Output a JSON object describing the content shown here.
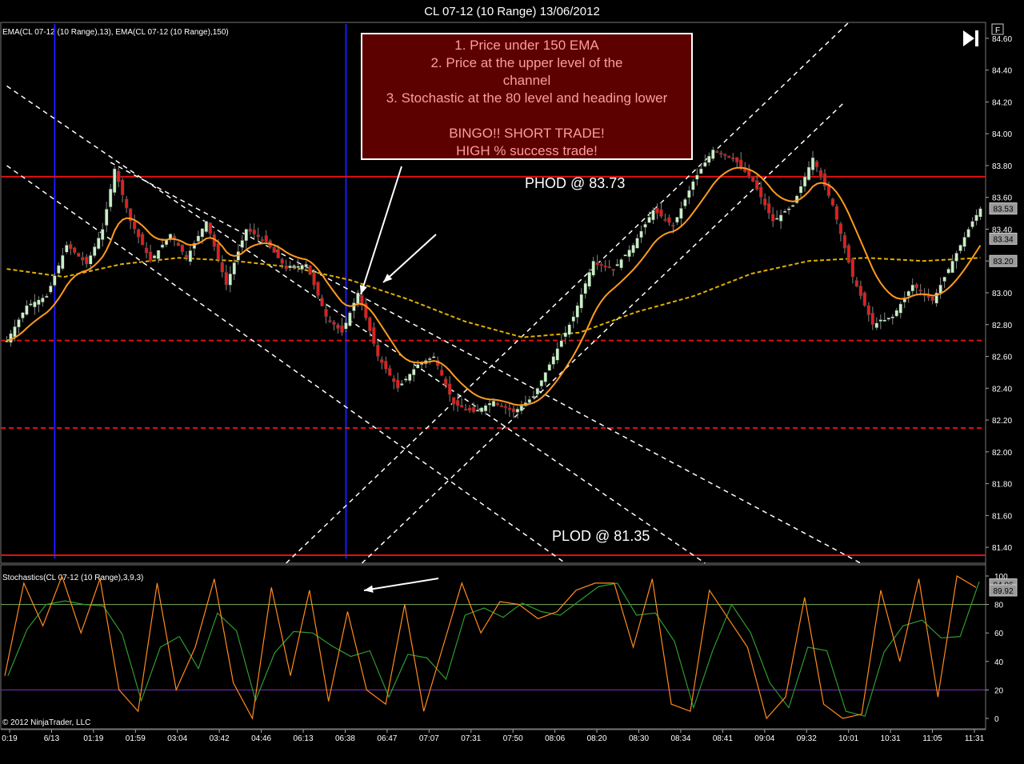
{
  "header": {
    "title": "CL 07-12 (10 Range)  13/06/2012"
  },
  "price_panel": {
    "indicator_label": "EMA(CL 07-12 (10 Range),13), EMA(CL 07-12 (10 Range),150)",
    "axis_ticks": [
      "84.60",
      "84.40",
      "84.20",
      "84.00",
      "83.80",
      "83.60",
      "83.40",
      "83.20",
      "83.00",
      "82.80",
      "82.60",
      "82.40",
      "82.20",
      "82.00",
      "81.80",
      "81.60",
      "81.40"
    ],
    "badges": [
      "83.53",
      "83.34",
      "83.20"
    ],
    "callout": {
      "text": "1. Price under 150 EMA\n2. Price at the upper level of the\nchannel\n3. Stochastic at the 80 level and heading lower\n\nBINGO!!  SHORT TRADE!\nHIGH % success trade!"
    },
    "phod_label": "PHOD @ 83.73",
    "plod_label": "PLOD @ 81.35",
    "f_button": "F",
    "play_icon": "skip-forward-icon"
  },
  "stoch_panel": {
    "indicator_label": "Stochastics(CL 07-12 (10 Range),3,9,3)",
    "axis_ticks": [
      "100",
      "80",
      "60",
      "40",
      "20",
      "0"
    ],
    "badges": [
      "94.06",
      "89.92"
    ],
    "copyright": "© 2012 NinjaTrader, LLC"
  },
  "x_axis": {
    "ticks": [
      "0:19",
      "6/13",
      "01:19",
      "01:59",
      "03:04",
      "03:42",
      "04:46",
      "06:13",
      "06:38",
      "06:47",
      "07:07",
      "07:31",
      "07:50",
      "08:06",
      "08:20",
      "08:30",
      "08:34",
      "08:41",
      "09:04",
      "09:32",
      "10:01",
      "10:31",
      "11:05",
      "11:31"
    ]
  },
  "colors": {
    "background": "#000000",
    "up_candle": "#c8f0c8",
    "down_candle": "#e02020",
    "ema13": "#ff9a1e",
    "ema150": "#e0b000",
    "level_line": "#e01010",
    "session_line": "#1a1aff",
    "stoch_k": "#ff8a1e",
    "stoch_d": "#2f9a2f",
    "stoch_80": "#78b060",
    "stoch_20": "#8030c0",
    "channel": "#ffffff"
  },
  "chart_data": [
    {
      "type": "candlestick",
      "title": "CL 07-12 (10 Range)  13/06/2012",
      "ylim": [
        81.3,
        84.7
      ],
      "x_labels": [
        "0:19",
        "6/13",
        "01:19",
        "01:59",
        "03:04",
        "03:42",
        "04:46",
        "06:13",
        "06:38",
        "06:47",
        "07:07",
        "07:31",
        "07:50",
        "08:06",
        "08:20",
        "08:30",
        "08:34",
        "08:41",
        "09:04",
        "09:32",
        "10:01",
        "10:31",
        "11:05",
        "11:31"
      ],
      "close_path": [
        {
          "bar": 0,
          "price": 82.7
        },
        {
          "bar": 5,
          "price": 82.92
        },
        {
          "bar": 10,
          "price": 82.98
        },
        {
          "bar": 15,
          "price": 83.3
        },
        {
          "bar": 20,
          "price": 83.18
        },
        {
          "bar": 24,
          "price": 83.4
        },
        {
          "bar": 27,
          "price": 83.78
        },
        {
          "bar": 31,
          "price": 83.45
        },
        {
          "bar": 36,
          "price": 83.2
        },
        {
          "bar": 41,
          "price": 83.37
        },
        {
          "bar": 45,
          "price": 83.22
        },
        {
          "bar": 50,
          "price": 83.45
        },
        {
          "bar": 55,
          "price": 83.05
        },
        {
          "bar": 60,
          "price": 83.4
        },
        {
          "bar": 65,
          "price": 83.32
        },
        {
          "bar": 70,
          "price": 83.15
        },
        {
          "bar": 75,
          "price": 83.18
        },
        {
          "bar": 80,
          "price": 82.85
        },
        {
          "bar": 84,
          "price": 82.75
        },
        {
          "bar": 88,
          "price": 83.0
        },
        {
          "bar": 93,
          "price": 82.6
        },
        {
          "bar": 98,
          "price": 82.4
        },
        {
          "bar": 103,
          "price": 82.55
        },
        {
          "bar": 107,
          "price": 82.6
        },
        {
          "bar": 112,
          "price": 82.3
        },
        {
          "bar": 117,
          "price": 82.25
        },
        {
          "bar": 122,
          "price": 82.32
        },
        {
          "bar": 127,
          "price": 82.25
        },
        {
          "bar": 132,
          "price": 82.35
        },
        {
          "bar": 137,
          "price": 82.6
        },
        {
          "bar": 142,
          "price": 82.85
        },
        {
          "bar": 147,
          "price": 83.2
        },
        {
          "bar": 152,
          "price": 83.15
        },
        {
          "bar": 157,
          "price": 83.3
        },
        {
          "bar": 162,
          "price": 83.52
        },
        {
          "bar": 167,
          "price": 83.42
        },
        {
          "bar": 172,
          "price": 83.7
        },
        {
          "bar": 177,
          "price": 83.9
        },
        {
          "bar": 182,
          "price": 83.85
        },
        {
          "bar": 187,
          "price": 83.7
        },
        {
          "bar": 192,
          "price": 83.45
        },
        {
          "bar": 197,
          "price": 83.55
        },
        {
          "bar": 202,
          "price": 83.85
        },
        {
          "bar": 207,
          "price": 83.55
        },
        {
          "bar": 212,
          "price": 83.1
        },
        {
          "bar": 217,
          "price": 82.8
        },
        {
          "bar": 222,
          "price": 82.85
        },
        {
          "bar": 227,
          "price": 83.05
        },
        {
          "bar": 232,
          "price": 82.95
        },
        {
          "bar": 237,
          "price": 83.2
        },
        {
          "bar": 242,
          "price": 83.45
        },
        {
          "bar": 244,
          "price": 83.53
        }
      ],
      "horizontal_levels": [
        {
          "price": 83.73,
          "style": "solid"
        },
        {
          "price": 82.7,
          "style": "dashed"
        },
        {
          "price": 82.15,
          "style": "dashed"
        },
        {
          "price": 81.35,
          "style": "solid"
        }
      ],
      "ema150_path": [
        83.15,
        83.1,
        83.18,
        83.22,
        83.2,
        83.16,
        83.08,
        82.96,
        82.82,
        82.72,
        82.75,
        82.88,
        82.98,
        83.12,
        83.2,
        83.22,
        83.2,
        83.22
      ]
    },
    {
      "type": "line",
      "title": "Stochastics(CL 07-12 (10 Range),3,9,3)",
      "ylim": [
        0,
        100
      ],
      "y_ticks": [
        0,
        20,
        40,
        60,
        80,
        100
      ],
      "reference_levels": [
        80,
        20
      ],
      "k_values": [
        30,
        95,
        65,
        100,
        60,
        98,
        20,
        5,
        95,
        20,
        50,
        98,
        25,
        0,
        92,
        30,
        90,
        12,
        75,
        20,
        10,
        80,
        5,
        50,
        95,
        60,
        82,
        80,
        70,
        75,
        90,
        95,
        95,
        50,
        98,
        10,
        5,
        90,
        70,
        50,
        0,
        15,
        85,
        10,
        0,
        3,
        90,
        40,
        98,
        15,
        100,
        92
      ]
    }
  ]
}
